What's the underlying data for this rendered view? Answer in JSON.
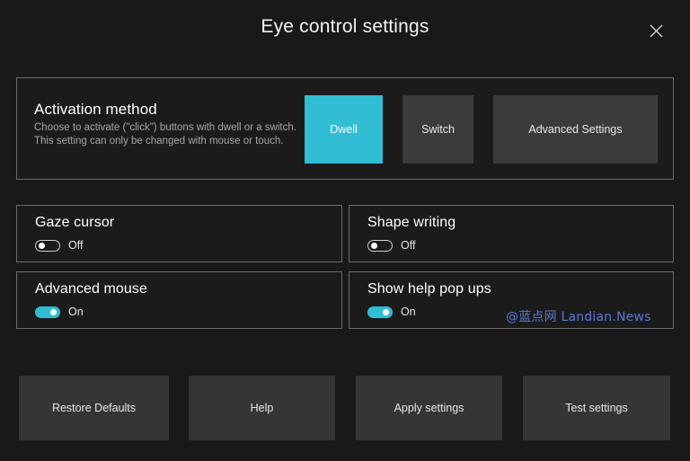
{
  "window": {
    "title": "Eye control settings",
    "close_icon": "close-icon",
    "background_color": "#191919",
    "accent_color": "#31bdd4"
  },
  "activation": {
    "title": "Activation method",
    "description": "Choose to activate (\"click\") buttons with dwell or a switch. This setting can only be changed with mouse or touch.",
    "options": [
      {
        "label": "Dwell",
        "selected": true
      },
      {
        "label": "Switch",
        "selected": false
      },
      {
        "label": "Advanced Settings",
        "selected": false
      }
    ]
  },
  "toggles": [
    {
      "label": "Gaze cursor",
      "state": "Off",
      "on": false
    },
    {
      "label": "Shape writing",
      "state": "Off",
      "on": false
    },
    {
      "label": "Advanced mouse",
      "state": "On",
      "on": true
    },
    {
      "label": "Show help pop ups",
      "state": "On",
      "on": true
    }
  ],
  "watermark": {
    "text": "@蓝点网 Landian.News",
    "color": "#5a77d6"
  },
  "footer": {
    "buttons": [
      {
        "label": "Restore Defaults"
      },
      {
        "label": "Help"
      },
      {
        "label": "Apply settings"
      },
      {
        "label": "Test settings"
      }
    ]
  }
}
